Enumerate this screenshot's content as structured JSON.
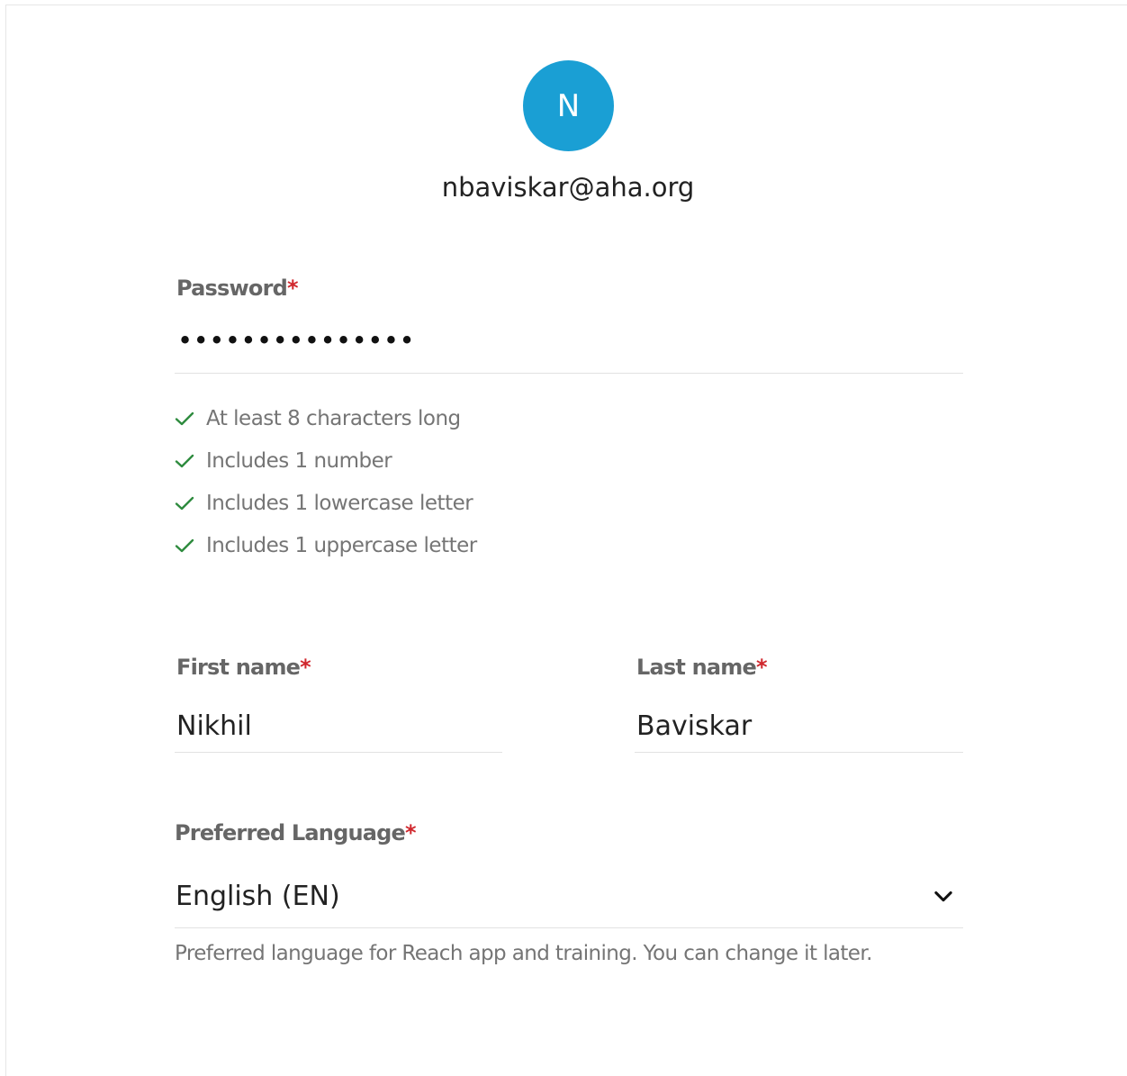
{
  "account": {
    "avatar_initial": "N",
    "email": "nbaviskar@aha.org",
    "avatar_color": "#1a9fd4"
  },
  "password": {
    "label": "Password",
    "required_mark": "*",
    "masked_value": "•••••••••••••••",
    "rules": [
      {
        "text": "At least 8 characters long",
        "icon": "check-icon",
        "met": true
      },
      {
        "text": "Includes 1 number",
        "icon": "check-icon",
        "met": true
      },
      {
        "text": "Includes 1 lowercase letter",
        "icon": "check-icon",
        "met": true
      },
      {
        "text": "Includes 1 uppercase letter",
        "icon": "check-icon",
        "met": true
      }
    ],
    "rule_met_color": "#2e8b3e"
  },
  "first_name": {
    "label": "First name",
    "required_mark": "*",
    "value": "Nikhil"
  },
  "last_name": {
    "label": "Last name",
    "required_mark": "*",
    "value": "Baviskar"
  },
  "language": {
    "label": "Preferred Language",
    "required_mark": "*",
    "selected": "English (EN)",
    "icon": "chevron-down-icon",
    "hint": "Preferred language for Reach app and training. You can change it later."
  },
  "colors": {
    "required": "#d0272d",
    "label": "#666666",
    "border": "#e2e2e2"
  }
}
